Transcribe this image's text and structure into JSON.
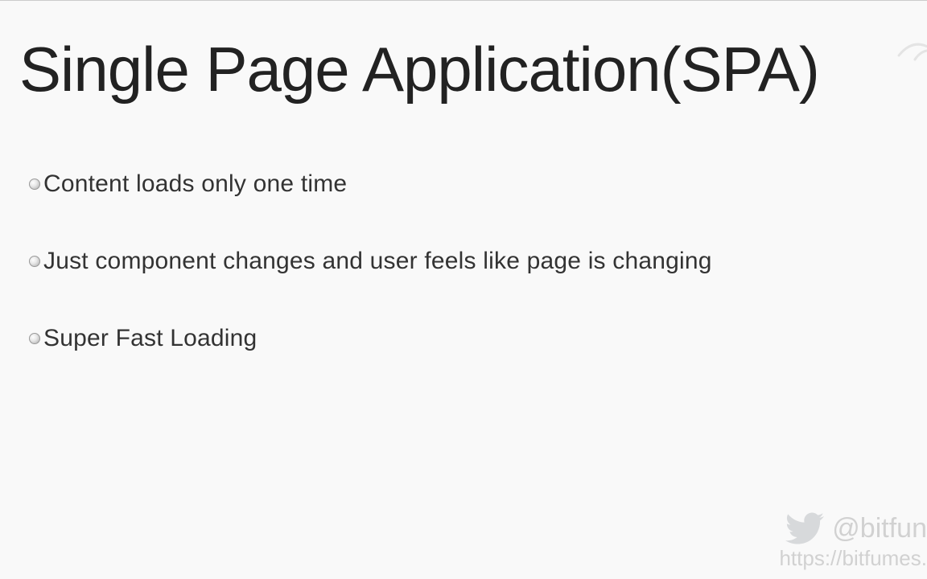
{
  "title": "Single Page Application(SPA)",
  "bullets": [
    "Content loads only one time",
    "Just component changes and user feels like page is changing",
    "Super Fast Loading"
  ],
  "twitter_handle": "@bitfun",
  "site_url": "https://bitfumes."
}
